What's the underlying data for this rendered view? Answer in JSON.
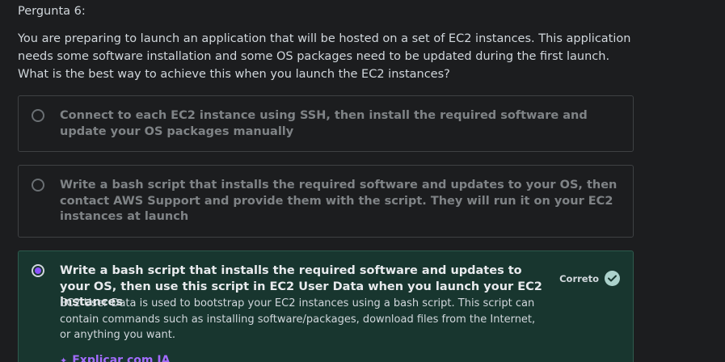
{
  "question": {
    "number_label": "Pergunta 6:",
    "text": "You are preparing to launch an application that will be hosted on a set of EC2 instances. This application needs some software installation and some OS packages need to be updated during the first launch. What is the best way to achieve this when you launch the EC2 instances?"
  },
  "options": [
    {
      "label": "Connect to each EC2 instance using SSH, then install the required software and update your OS packages manually",
      "selected": false
    },
    {
      "label": "Write a bash script that installs the required software and updates to your OS, then contact AWS Support and provide them with the script. They will run it on your EC2 instances at launch",
      "selected": false
    },
    {
      "label": "Write a bash script that installs the required software and updates to your OS, then use this script in EC2 User Data when you launch your EC2 instances",
      "selected": true,
      "status_label": "Correto",
      "explanation": "EC2 User Data is used to bootstrap your EC2 instances using a bash script. This script can contain commands such as installing software/packages, download files from the Internet, or anything you want."
    }
  ],
  "explain_ai_label": "Explicar com IA",
  "colors": {
    "background": "#1c1d1f",
    "correct_background": "#18362f",
    "accent_purple": "#a36cff",
    "check_green": "#acd2cc"
  },
  "icons": {
    "check": "check-circle-icon",
    "sparkle": "sparkle-icon"
  }
}
